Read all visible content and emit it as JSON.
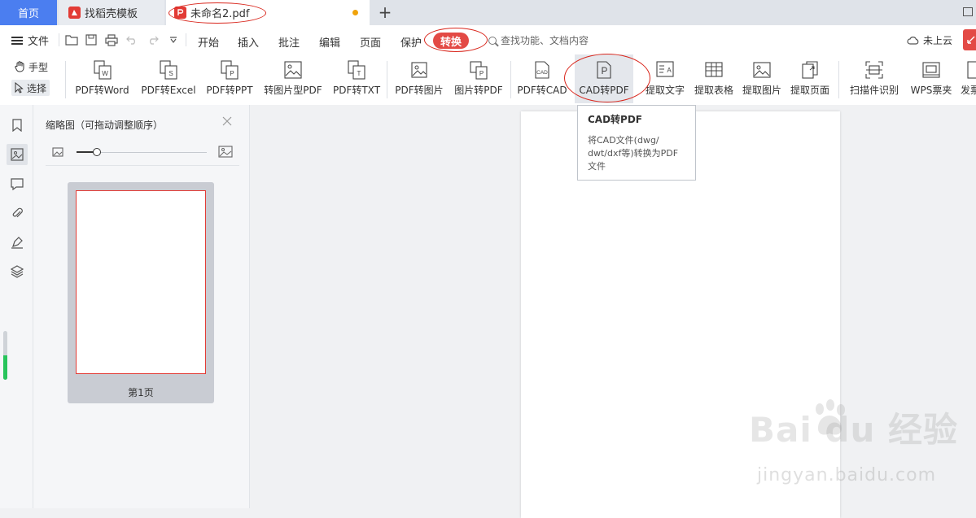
{
  "tabs": {
    "home": "首页",
    "templates": "找稻壳模板",
    "document": "未命名2.pdf",
    "add": "+"
  },
  "menubar": {
    "file": "文件",
    "items": [
      "开始",
      "插入",
      "批注",
      "编辑",
      "页面",
      "保护"
    ],
    "active": "转换",
    "search_placeholder": "查找功能、文档内容",
    "cloud": "未上云"
  },
  "ribbon": {
    "hand": "手型",
    "select": "选择",
    "buttons": [
      "PDF转Word",
      "PDF转Excel",
      "PDF转PPT",
      "转图片型PDF",
      "PDF转TXT",
      "PDF转图片",
      "图片转PDF",
      "PDF转CAD",
      "CAD转PDF",
      "提取文字",
      "提取表格",
      "提取图片",
      "提取页面",
      "扫描件识别",
      "WPS票夹",
      "发票"
    ]
  },
  "tooltip": {
    "title": "CAD转PDF",
    "desc_line1": "将CAD文件(dwg/",
    "desc_line2": "dwt/dxf等)转换为PDF",
    "desc_line3": "文件"
  },
  "thumbnails": {
    "title": "缩略图（可拖动调整顺序）",
    "page_label": "第1页"
  },
  "watermark": {
    "logo": "Bai du 经验",
    "url": "jingyan.baidu.com"
  },
  "colors": {
    "accent_blue": "#4b7ef0",
    "accent_red": "#e34a45",
    "annotation_red": "#d9261c"
  },
  "icons": [
    "hamburger-icon",
    "folder-icon",
    "save-icon",
    "print-icon",
    "undo-icon",
    "redo-icon",
    "dropdown-icon",
    "search-icon",
    "cloud-icon",
    "hand-icon",
    "cursor-icon",
    "bookmark-icon",
    "thumbnail-icon",
    "comment-icon",
    "attachment-icon",
    "signature-icon",
    "layers-icon",
    "close-icon",
    "image-small-icon",
    "image-large-icon"
  ]
}
